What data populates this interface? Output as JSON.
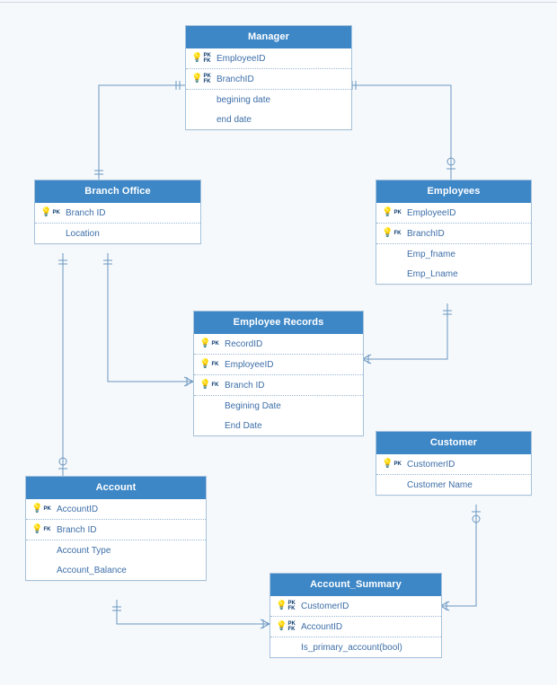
{
  "entities": {
    "manager": {
      "title": "Manager",
      "rows": [
        {
          "keys": [
            "PK",
            "FK"
          ],
          "name": "EmployeeID"
        },
        {
          "keys": [
            "PK",
            "FK"
          ],
          "name": "BranchID"
        },
        {
          "keys": [],
          "name": "begining date"
        },
        {
          "keys": [],
          "name": "end date"
        }
      ]
    },
    "branchOffice": {
      "title": "Branch Office",
      "rows": [
        {
          "keys": [
            "PK"
          ],
          "name": "Branch ID"
        },
        {
          "keys": [],
          "name": "Location"
        }
      ]
    },
    "employees": {
      "title": "Employees",
      "rows": [
        {
          "keys": [
            "PK"
          ],
          "name": "EmployeeID"
        },
        {
          "keys": [
            "FK"
          ],
          "name": "BranchID"
        },
        {
          "keys": [],
          "name": "Emp_fname"
        },
        {
          "keys": [],
          "name": "Emp_Lname"
        }
      ]
    },
    "employeeRecords": {
      "title": "Employee Records",
      "rows": [
        {
          "keys": [
            "PK"
          ],
          "name": "RecordID"
        },
        {
          "keys": [
            "FK"
          ],
          "name": "EmployeeID"
        },
        {
          "keys": [
            "FK"
          ],
          "name": "Branch ID"
        },
        {
          "keys": [],
          "name": "Begining Date"
        },
        {
          "keys": [],
          "name": "End Date"
        }
      ]
    },
    "customer": {
      "title": "Customer",
      "rows": [
        {
          "keys": [
            "PK"
          ],
          "name": "CustomerID"
        },
        {
          "keys": [],
          "name": "Customer Name"
        }
      ]
    },
    "account": {
      "title": "Account",
      "rows": [
        {
          "keys": [
            "PK"
          ],
          "name": "AccountID"
        },
        {
          "keys": [
            "FK"
          ],
          "name": "Branch ID"
        },
        {
          "keys": [],
          "name": "Account Type"
        },
        {
          "keys": [],
          "name": "Account_Balance"
        }
      ]
    },
    "accountSummary": {
      "title": "Account_Summary",
      "rows": [
        {
          "keys": [
            "PK",
            "FK"
          ],
          "name": "CustomerID"
        },
        {
          "keys": [
            "PK",
            "FK"
          ],
          "name": "AccountID"
        },
        {
          "keys": [],
          "name": "Is_primary_account(bool)"
        }
      ]
    }
  },
  "chart_data": {
    "type": "table",
    "title": "Entity-Relationship Diagram",
    "entities": [
      {
        "name": "Manager",
        "attributes": [
          {
            "name": "EmployeeID",
            "keys": [
              "PK",
              "FK"
            ]
          },
          {
            "name": "BranchID",
            "keys": [
              "PK",
              "FK"
            ]
          },
          {
            "name": "begining date",
            "keys": []
          },
          {
            "name": "end date",
            "keys": []
          }
        ]
      },
      {
        "name": "Branch Office",
        "attributes": [
          {
            "name": "Branch ID",
            "keys": [
              "PK"
            ]
          },
          {
            "name": "Location",
            "keys": []
          }
        ]
      },
      {
        "name": "Employees",
        "attributes": [
          {
            "name": "EmployeeID",
            "keys": [
              "PK"
            ]
          },
          {
            "name": "BranchID",
            "keys": [
              "FK"
            ]
          },
          {
            "name": "Emp_fname",
            "keys": []
          },
          {
            "name": "Emp_Lname",
            "keys": []
          }
        ]
      },
      {
        "name": "Employee Records",
        "attributes": [
          {
            "name": "RecordID",
            "keys": [
              "PK"
            ]
          },
          {
            "name": "EmployeeID",
            "keys": [
              "FK"
            ]
          },
          {
            "name": "Branch ID",
            "keys": [
              "FK"
            ]
          },
          {
            "name": "Begining Date",
            "keys": []
          },
          {
            "name": "End Date",
            "keys": []
          }
        ]
      },
      {
        "name": "Customer",
        "attributes": [
          {
            "name": "CustomerID",
            "keys": [
              "PK"
            ]
          },
          {
            "name": "Customer Name",
            "keys": []
          }
        ]
      },
      {
        "name": "Account",
        "attributes": [
          {
            "name": "AccountID",
            "keys": [
              "PK"
            ]
          },
          {
            "name": "Branch ID",
            "keys": [
              "FK"
            ]
          },
          {
            "name": "Account Type",
            "keys": []
          },
          {
            "name": "Account_Balance",
            "keys": []
          }
        ]
      },
      {
        "name": "Account_Summary",
        "attributes": [
          {
            "name": "CustomerID",
            "keys": [
              "PK",
              "FK"
            ]
          },
          {
            "name": "AccountID",
            "keys": [
              "PK",
              "FK"
            ]
          },
          {
            "name": "Is_primary_account(bool)",
            "keys": []
          }
        ]
      }
    ],
    "relationships": [
      {
        "from": "Manager.BranchID",
        "to": "Branch Office.Branch ID",
        "fromCard": "one-mandatory",
        "toCard": "one-mandatory"
      },
      {
        "from": "Manager.EmployeeID",
        "to": "Employees.EmployeeID",
        "fromCard": "one-optional",
        "toCard": "one-mandatory"
      },
      {
        "from": "Employees.BranchID",
        "to": "Branch Office.Branch ID",
        "fromCard": "many-mandatory",
        "toCard": "one-mandatory"
      },
      {
        "from": "Employee Records.Branch ID",
        "to": "Branch Office.Branch ID",
        "fromCard": "many-mandatory",
        "toCard": "one-mandatory"
      },
      {
        "from": "Employee Records.EmployeeID",
        "to": "Employees.EmployeeID",
        "fromCard": "many-mandatory",
        "toCard": "one-mandatory"
      },
      {
        "from": "Account.Branch ID",
        "to": "Branch Office.Branch ID",
        "fromCard": "many-mandatory",
        "toCard": "one-mandatory"
      },
      {
        "from": "Account_Summary.AccountID",
        "to": "Account.AccountID",
        "fromCard": "many-mandatory",
        "toCard": "one-mandatory"
      },
      {
        "from": "Account_Summary.CustomerID",
        "to": "Customer.CustomerID",
        "fromCard": "many-mandatory",
        "toCard": "one-optional"
      }
    ]
  }
}
